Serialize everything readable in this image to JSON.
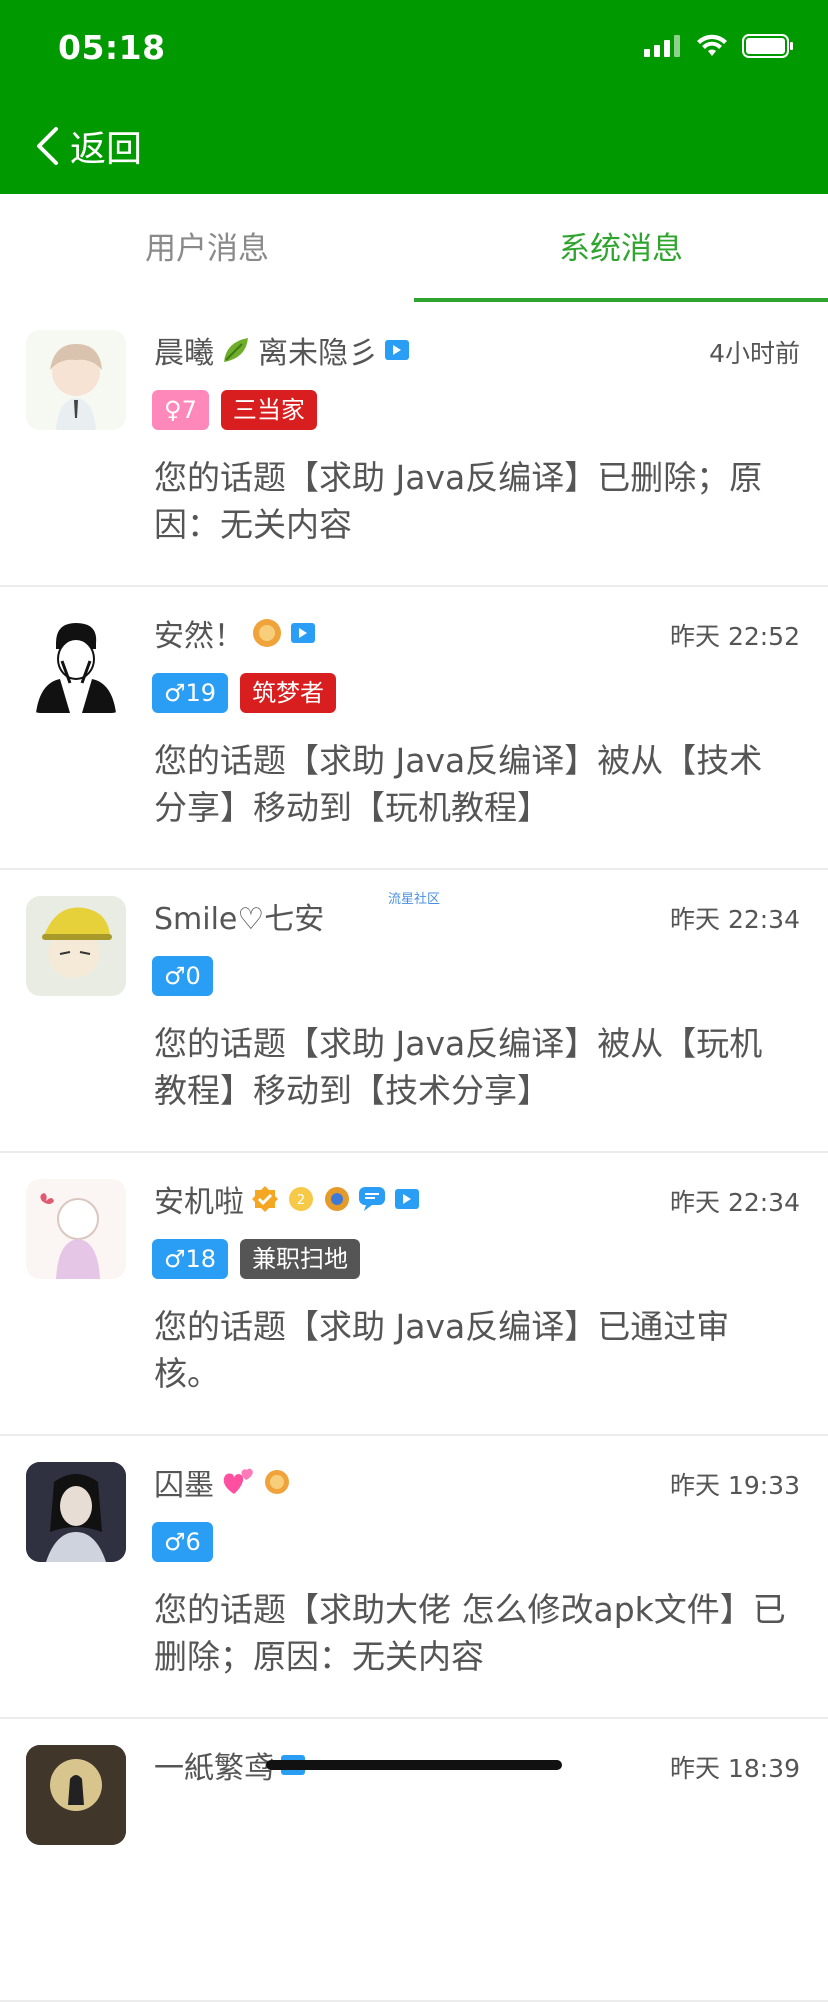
{
  "status_bar": {
    "time": "05:18"
  },
  "nav": {
    "back_label": "返回"
  },
  "tabs": [
    {
      "label": "用户消息",
      "active": false
    },
    {
      "label": "系统消息",
      "active": true
    }
  ],
  "watermark": "流星社区",
  "items": [
    {
      "name": "晨曦",
      "name_suffix": "离未隐彡",
      "time": "4小时前",
      "badges": [
        {
          "text": "♀7",
          "color": "#ff88bb"
        },
        {
          "text": "三当家",
          "color": "#d81e1e"
        }
      ],
      "message": "您的话题【求助 Java反编译】已删除；原因：无关内容"
    },
    {
      "name": "安然！",
      "time": "昨天 22:52",
      "badges": [
        {
          "text": "♂19",
          "color": "#2a9df4"
        },
        {
          "text": "筑梦者",
          "color": "#d81e1e"
        }
      ],
      "message": "您的话题【求助 Java反编译】被从【技术分享】移动到【玩机教程】"
    },
    {
      "name": "Smile♡七安",
      "time": "昨天 22:34",
      "badges": [
        {
          "text": "♂0",
          "color": "#2a9df4"
        }
      ],
      "message": "您的话题【求助 Java反编译】被从【玩机教程】移动到【技术分享】"
    },
    {
      "name": "安机啦",
      "time": "昨天 22:34",
      "badges": [
        {
          "text": "♂18",
          "color": "#2a9df4"
        },
        {
          "text": "兼职扫地",
          "color": "#555555"
        }
      ],
      "message": "您的话题【求助 Java反编译】已通过审核。"
    },
    {
      "name": "囚墨",
      "time": "昨天 19:33",
      "badges": [
        {
          "text": "♂6",
          "color": "#2a9df4"
        }
      ],
      "message": "您的话题【求助大佬 怎么修改apk文件】已删除；原因：无关内容"
    },
    {
      "name": "一紙繁鸢",
      "time": "昨天 18:39",
      "badges": [],
      "message": ""
    }
  ]
}
